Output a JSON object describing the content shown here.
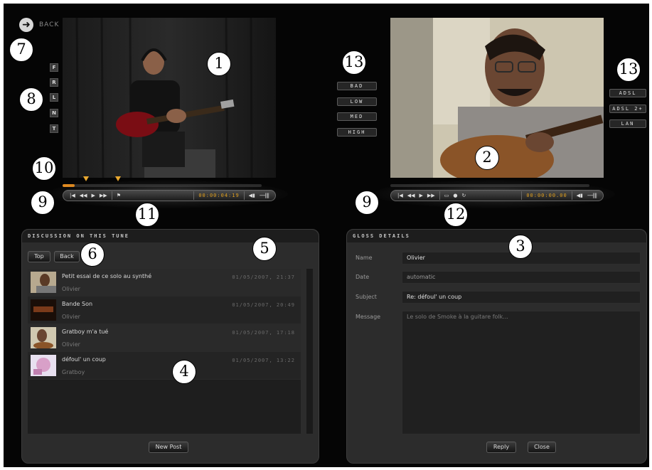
{
  "annotations": {
    "n1": "1",
    "n2": "2",
    "n3": "3",
    "n4": "4",
    "n5": "5",
    "n6": "6",
    "n7": "7",
    "n8": "8",
    "n9a": "9",
    "n9b": "9",
    "n10": "10",
    "n11": "11",
    "n12": "12",
    "n13a": "13",
    "n13b": "13"
  },
  "back": {
    "label": "BACK",
    "icon": "back-arrow-icon"
  },
  "camera_views": [
    "F",
    "R",
    "L",
    "N",
    "T"
  ],
  "quality_buttons": [
    "BAD",
    "LOW",
    "MED",
    "HIGH"
  ],
  "connection_buttons": [
    "ADSL",
    "ADSL 2+",
    "LAN"
  ],
  "left_player": {
    "timecode": "00:00:04:19",
    "icons": [
      "skip-back-icon",
      "rewind-icon",
      "play-icon",
      "fast-forward-icon",
      "flag-icon",
      "volume-icon"
    ],
    "progress": 0.06
  },
  "right_player": {
    "timecode": "00:00:00.00",
    "icons": [
      "skip-back-icon",
      "rewind-icon",
      "play-icon",
      "fast-forward-icon",
      "screen-icon",
      "record-icon",
      "loop-icon",
      "volume-icon"
    ]
  },
  "discussion": {
    "title": "DISCUSSION ON THIS TUNE",
    "top_button": "Top",
    "back_button": "Back",
    "new_post_button": "New Post",
    "posts": [
      {
        "title": "Petit essai de ce solo au synthé",
        "author": "Olivier",
        "date": "01/05/2007, 21:37"
      },
      {
        "title": "Bande Son",
        "author": "Olivier",
        "date": "01/05/2007, 20:49"
      },
      {
        "title": "Gratboy m'a tué",
        "author": "Olivier",
        "date": "01/05/2007, 17:18"
      },
      {
        "title": "défoul' un coup",
        "author": "Gratboy",
        "date": "01/05/2007, 13:22"
      }
    ]
  },
  "gloss": {
    "title": "GLOSS DETAILS",
    "labels": {
      "name": "Name",
      "date": "Date",
      "subject": "Subject",
      "message": "Message"
    },
    "values": {
      "name": "Olivier",
      "date": "automatic",
      "subject": "Re: défoul' un coup",
      "message": "Le solo de Smoke à la guitare folk..."
    },
    "reply_button": "Reply",
    "close_button": "Close"
  }
}
